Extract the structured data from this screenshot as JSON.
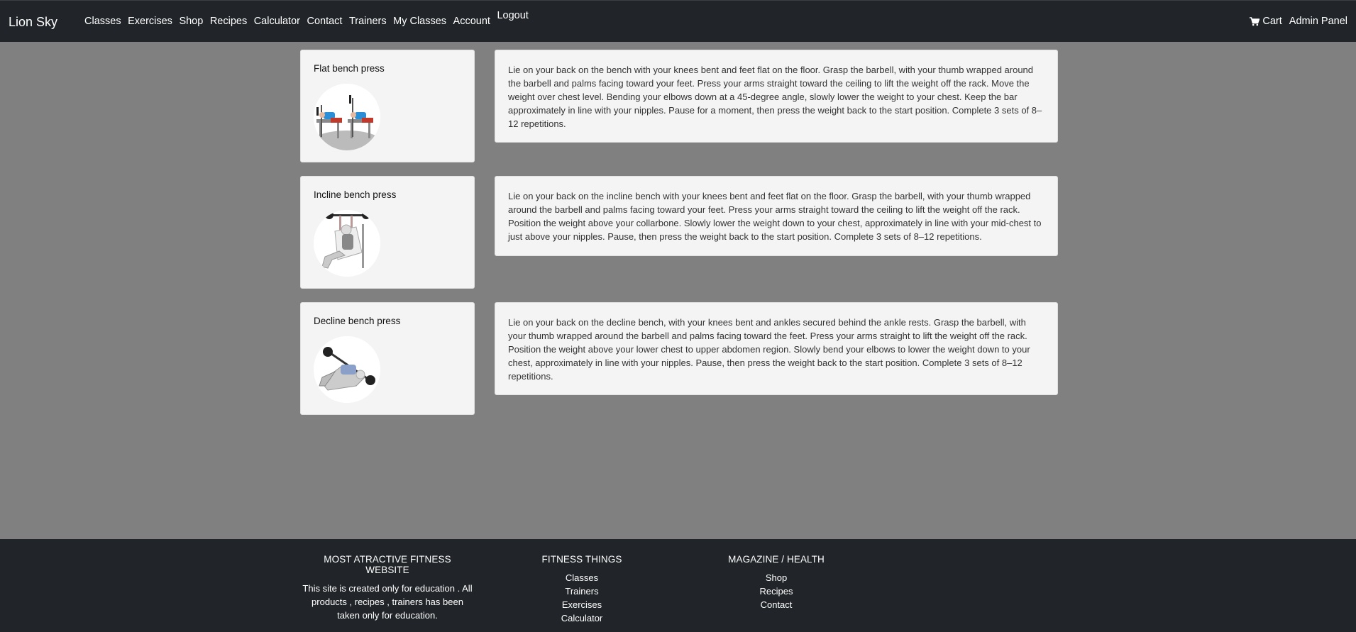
{
  "nav": {
    "brand": "Lion Sky",
    "links": [
      "Classes",
      "Exercises",
      "Shop",
      "Recipes",
      "Calculator",
      "Contact",
      "Trainers",
      "My Classes",
      "Account"
    ],
    "logout": "Logout",
    "cart": "Cart",
    "admin": "Admin Panel"
  },
  "exercises": [
    {
      "name": "Flat bench press",
      "description": "Lie on your back on the bench with your knees bent and feet flat on the floor. Grasp the barbell, with your thumb wrapped around the barbell and palms facing toward your feet. Press your arms straight toward the ceiling to lift the weight off the rack. Move the weight over chest level. Bending your elbows down at a 45-degree angle, slowly lower the weight to your chest. Keep the bar approximately in line with your nipples. Pause for a moment, then press the weight back to the start position. Complete 3 sets of 8–12 repetitions."
    },
    {
      "name": "Incline bench press",
      "description": "Lie on your back on the incline bench with your knees bent and feet flat on the floor. Grasp the barbell, with your thumb wrapped around the barbell and palms facing toward your feet. Press your arms straight toward the ceiling to lift the weight off the rack. Position the weight above your collarbone. Slowly lower the weight down to your chest, approximately in line with your mid-chest to just above your nipples. Pause, then press the weight back to the start position. Complete 3 sets of 8–12 repetitions."
    },
    {
      "name": "Decline bench press",
      "description": "Lie on your back on the decline bench, with your knees bent and ankles secured behind the ankle rests. Grasp the barbell, with your thumb wrapped around the barbell and palms facing toward the feet. Press your arms straight to lift the weight off the rack. Position the weight above your lower chest to upper abdomen region. Slowly bend your elbows to lower the weight down to your chest, approximately in line with your nipples. Pause, then press the weight back to the start position. Complete 3 sets of 8–12 repetitions."
    }
  ],
  "footer": {
    "col1": {
      "title": "MOST ATRACTIVE FITNESS WEBSITE",
      "text": "This site is created only for education . All products , recipes , trainers has been taken only for education."
    },
    "col2": {
      "title": "FITNESS THINGS",
      "links": [
        "Classes",
        "Trainers",
        "Exercises",
        "Calculator"
      ]
    },
    "col3": {
      "title": "MAGAZINE / HEALTH",
      "links": [
        "Shop",
        "Recipes",
        "Contact"
      ]
    }
  },
  "colors": {
    "navbar": "#212529",
    "page_bg": "#808080",
    "card_bg": "#f4f4f4"
  }
}
